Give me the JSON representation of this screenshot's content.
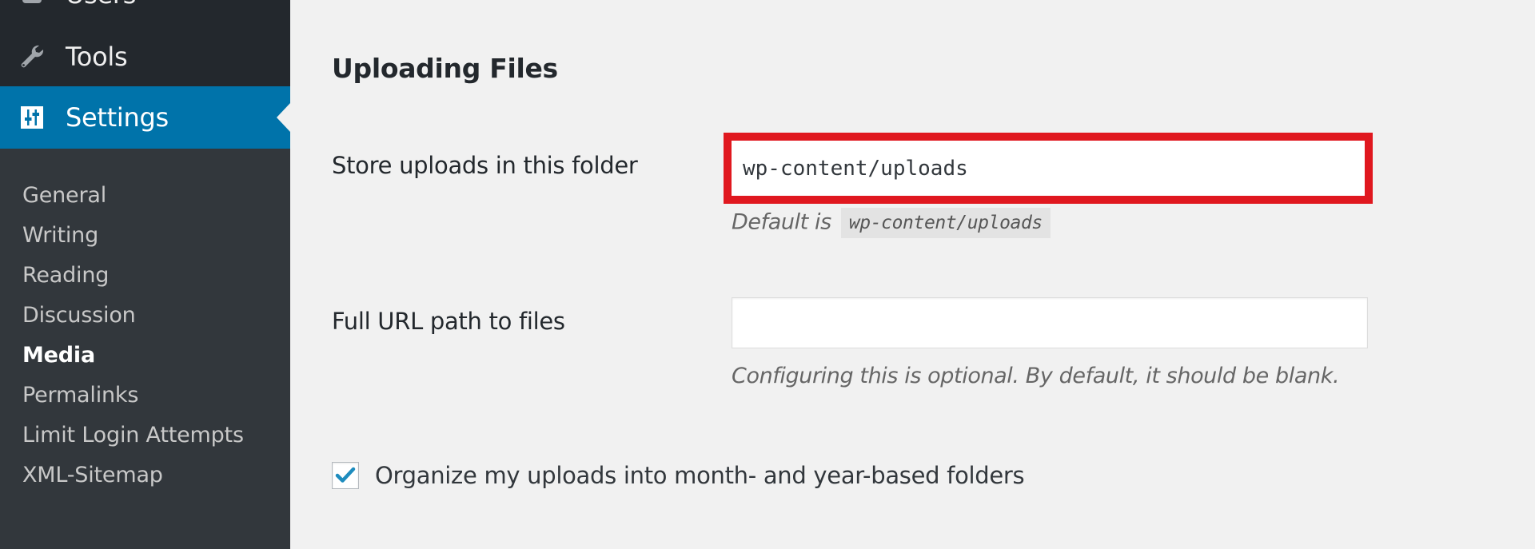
{
  "sidebar": {
    "menu": [
      {
        "label": "Users",
        "icon": "users-icon"
      },
      {
        "label": "Tools",
        "icon": "wrench-icon"
      },
      {
        "label": "Settings",
        "icon": "settings-sliders-icon",
        "active": true
      }
    ],
    "submenu": [
      {
        "label": "General"
      },
      {
        "label": "Writing"
      },
      {
        "label": "Reading"
      },
      {
        "label": "Discussion"
      },
      {
        "label": "Media",
        "current": true
      },
      {
        "label": "Permalinks"
      },
      {
        "label": "Limit Login Attempts"
      },
      {
        "label": "XML-Sitemap"
      }
    ]
  },
  "main": {
    "section_title": "Uploading Files",
    "upload_folder": {
      "label": "Store uploads in this folder",
      "value": "wp-content/uploads",
      "description_prefix": "Default is",
      "description_code": "wp-content/uploads",
      "highlight_color": "#e0181f"
    },
    "url_path": {
      "label": "Full URL path to files",
      "value": "",
      "description": "Configuring this is optional. By default, it should be blank."
    },
    "organize": {
      "label": "Organize my uploads into month- and year-based folders",
      "checked": true
    }
  },
  "colors": {
    "sidebar_bg": "#23282d",
    "submenu_bg": "#32373c",
    "accent": "#0073aa",
    "content_bg": "#f1f1f1",
    "checkmark": "#1e8cbe"
  }
}
